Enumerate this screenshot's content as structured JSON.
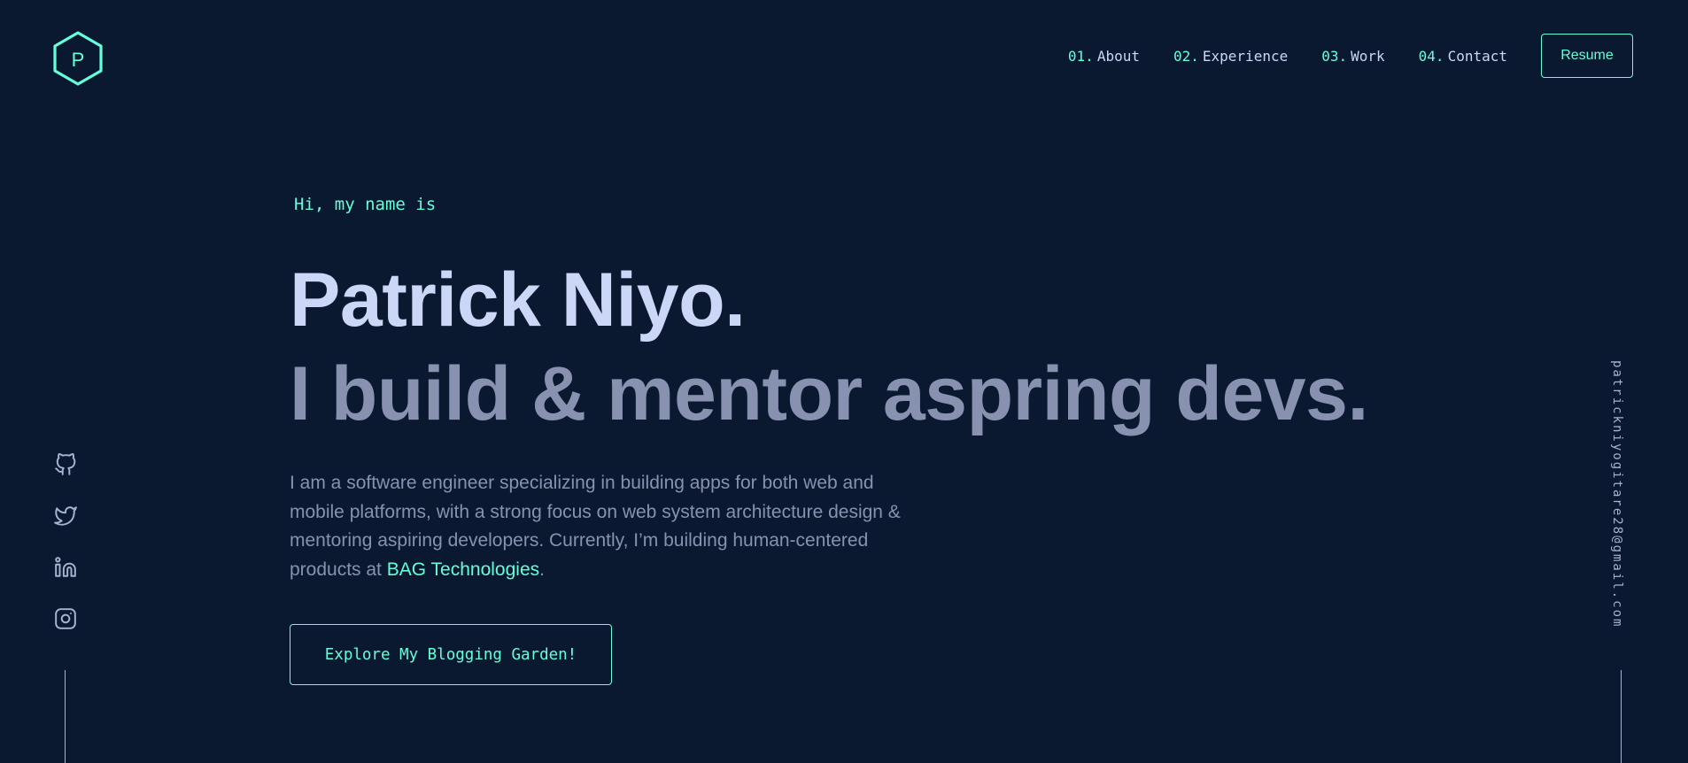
{
  "header": {
    "logo_letter": "P",
    "nav": [
      {
        "num": "01.",
        "label": "About"
      },
      {
        "num": "02.",
        "label": "Experience"
      },
      {
        "num": "03.",
        "label": "Work"
      },
      {
        "num": "04.",
        "label": "Contact"
      }
    ],
    "resume_label": "Resume"
  },
  "hero": {
    "greeting": "Hi, my name is",
    "name": "Patrick Niyo.",
    "tagline": "I build & mentor aspring devs.",
    "bio_text": "I am a software engineer specializing in building apps for both web and mobile platforms, with a strong focus on web system architecture design & mentoring aspiring developers. Currently, I’m building human-centered products at ",
    "bio_company": "BAG Technologies",
    "bio_end": ".",
    "cta_label": "Explore My Blogging Garden!"
  },
  "social": {
    "icons": [
      "github-icon",
      "twitter-icon",
      "linkedin-icon",
      "instagram-icon"
    ]
  },
  "email": "patrickniyogitare28@gmail.com",
  "colors": {
    "background": "#0a192f",
    "accent": "#64ffda",
    "heading": "#ccd6f6",
    "text": "#8892b0",
    "light_text": "#a8b2d1"
  }
}
